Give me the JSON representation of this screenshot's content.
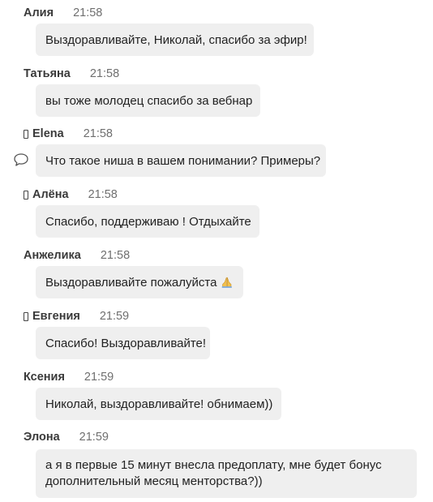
{
  "messages": [
    {
      "author": "Алия",
      "time": "21:58",
      "text": "Выздоравливайте, Николай, спасибо за эфир!",
      "author_icon": null,
      "has_reply_icon": false
    },
    {
      "author": "Татьяна",
      "time": "21:58",
      "text": "вы тоже молодец спасибо за вебнар",
      "author_icon": null,
      "has_reply_icon": false
    },
    {
      "author": "Elena",
      "time": "21:58",
      "text": "Что такое ниша в вашем понимании? Примеры?",
      "author_icon": "placeholder-glyph-icon",
      "has_reply_icon": true
    },
    {
      "author": "Алёна",
      "time": "21:58",
      "text": "Спасибо, поддерживаю ! Отдыхайте",
      "author_icon": "placeholder-glyph-icon",
      "has_reply_icon": false
    },
    {
      "author": "Анжелика",
      "time": "21:58",
      "text": "Выздоравливайте пожалуйста",
      "emoji": "folded-hands-icon",
      "author_icon": null,
      "has_reply_icon": false
    },
    {
      "author": "Евгения",
      "time": "21:59",
      "text": "Спасибо! Выздоравливайте!",
      "author_icon": "placeholder-glyph-icon",
      "has_reply_icon": false
    },
    {
      "author": "Ксения",
      "time": "21:59",
      "text": "Николай, выздоравливайте! обнимаем))",
      "author_icon": null,
      "has_reply_icon": false
    },
    {
      "author": "Элона",
      "time": "21:59",
      "text": "а я в первые 15 минут внесла предоплату, мне будет бонус дополнительный месяц менторства?))",
      "author_icon": null,
      "has_reply_icon": false
    }
  ],
  "colors": {
    "bubble_bg": "#efefef",
    "author_text": "#3a3a3a",
    "time_text": "#6f6f6f"
  }
}
